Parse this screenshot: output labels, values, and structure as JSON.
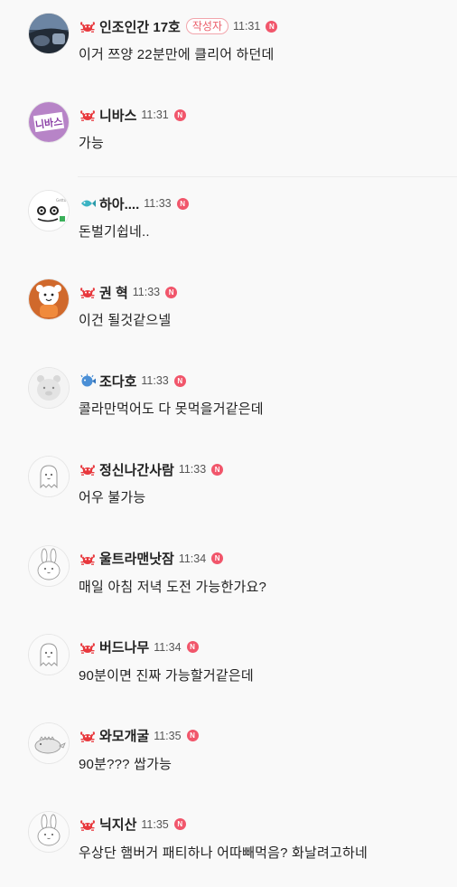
{
  "new_badge_label": "N",
  "author_badge_label": "작성자",
  "comments": [
    {
      "nickname": "인조인간 17호",
      "time": "11:31",
      "text": "이거 쯔양 22분만에 클리어 하던데",
      "level_icon": "crab-icon",
      "avatar": "car-photo-avatar",
      "is_author": true
    },
    {
      "nickname": "니바스",
      "time": "11:31",
      "text": "가능",
      "level_icon": "crab-icon",
      "avatar": "nibas-logo-avatar"
    },
    {
      "nickname": "하아....",
      "time": "11:33",
      "text": "돈벌기쉽네..",
      "level_icon": "fish-icon",
      "avatar": "cartoon-face-avatar"
    },
    {
      "nickname": "권 혁",
      "time": "11:33",
      "text": "이건 될것같으넬",
      "level_icon": "crab-icon",
      "avatar": "orange-character-avatar"
    },
    {
      "nickname": "조다호",
      "time": "11:33",
      "text": "콜라만먹어도 다 못먹을거같은데",
      "level_icon": "blowfish-icon",
      "avatar": "gray-bear-avatar"
    },
    {
      "nickname": "정신나간사람",
      "time": "11:33",
      "text": "어우 불가능",
      "level_icon": "crab-icon",
      "avatar": "ghost-avatar"
    },
    {
      "nickname": "울트라맨낫잠",
      "time": "11:34",
      "text": "매일 아침 저녁 도전 가능한가요?",
      "level_icon": "crab-icon",
      "avatar": "rabbit-avatar"
    },
    {
      "nickname": "버드나무",
      "time": "11:34",
      "text": "90분이면 진짜 가능할거같은데",
      "level_icon": "crab-icon",
      "avatar": "ghost-avatar"
    },
    {
      "nickname": "와모개굴",
      "time": "11:35",
      "text": "90분??? 쌉가능",
      "level_icon": "crab-icon",
      "avatar": "dinosaur-avatar"
    },
    {
      "nickname": "닉지산",
      "time": "11:35",
      "text": "우상단 햄버거 패티하나 어따빼먹음? 화날려고하네",
      "level_icon": "crab-icon",
      "avatar": "rabbit-avatar"
    }
  ],
  "colors": {
    "background": "#f9f9f9",
    "new_badge": "#f1566b",
    "author_badge_text": "#ea5d6a",
    "crab": "#e8383d",
    "fish": "#3bb3c3",
    "blowfish": "#4a8fd6"
  }
}
